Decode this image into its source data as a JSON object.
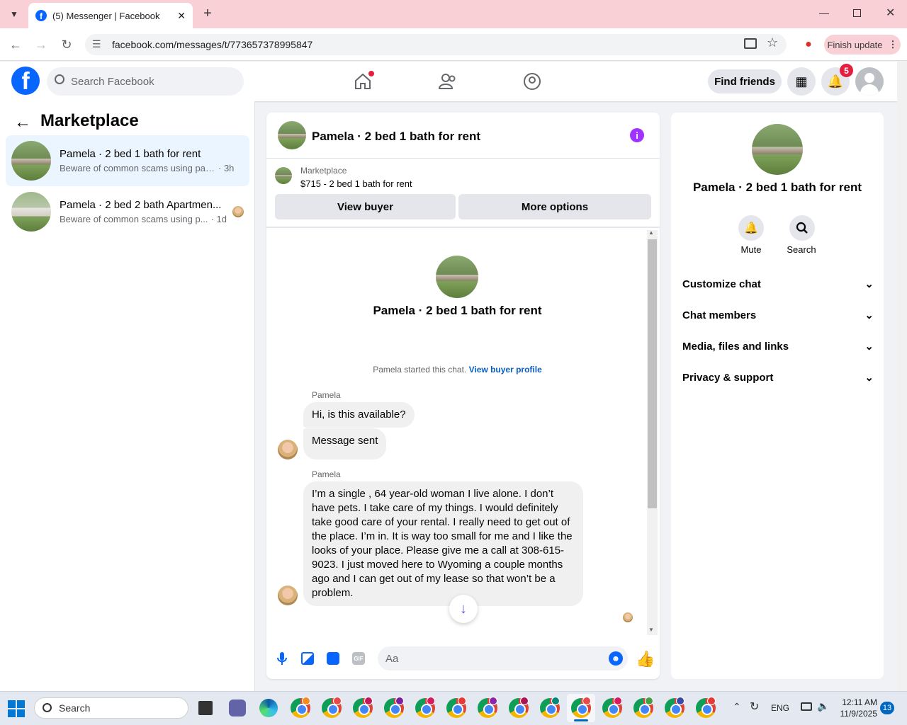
{
  "browser": {
    "tab_title": "(5) Messenger | Facebook",
    "url": "facebook.com/messages/t/773657378995847",
    "finish_update": "Finish update"
  },
  "header": {
    "search_placeholder": "Search Facebook",
    "find_friends": "Find friends",
    "notification_count": "5"
  },
  "sidebar": {
    "title": "Marketplace",
    "conversations": [
      {
        "name": "Pamela · 2 bed 1 bath for rent",
        "snippet": "Beware of common scams using pay...",
        "time": "· 3h",
        "selected": true
      },
      {
        "name": "Pamela · 2 bed 2 bath Apartmen...",
        "snippet": "Beware of common scams using p...",
        "time": "· 1d",
        "selected": false
      }
    ]
  },
  "chat": {
    "title": "Pamela · 2 bed 1 bath for rent",
    "listing_source": "Marketplace",
    "listing_desc": "$715 - 2 bed 1 bath for rent",
    "view_buyer": "View buyer",
    "more_options": "More options",
    "intro_name": "Pamela · 2 bed 1 bath for rent",
    "started_text": "Pamela started this chat.",
    "view_profile": "View buyer profile",
    "messages": [
      {
        "sender": "Pamela",
        "text": "Hi, is this available?"
      },
      {
        "text": "Message sent"
      },
      {
        "sender": "Pamela",
        "text": "I’m a single , 64 year-old woman I live alone. I don’t have pets. I take care of my things. I would definitely take good care of your rental. I really need to get out of the place. I’m in. It is way too small for me and I like the looks of your place. Please give me a call at 308-615-9023. I just moved here to Wyoming a couple months ago and I can get out of my lease so that won’t be a problem."
      }
    ],
    "composer_placeholder": "Aa"
  },
  "details": {
    "name": "Pamela · 2 bed 1 bath for rent",
    "mute": "Mute",
    "search": "Search",
    "sections": [
      "Customize chat",
      "Chat members",
      "Media, files and links",
      "Privacy & support"
    ]
  },
  "taskbar": {
    "search": "Search",
    "lang": "ENG",
    "time": "12:11 AM",
    "date": "11/9/2025",
    "badge": "13"
  },
  "colors": {
    "fb_blue": "#0866ff",
    "accent_purple": "#a033ff",
    "notif_red": "#e41e3f"
  }
}
